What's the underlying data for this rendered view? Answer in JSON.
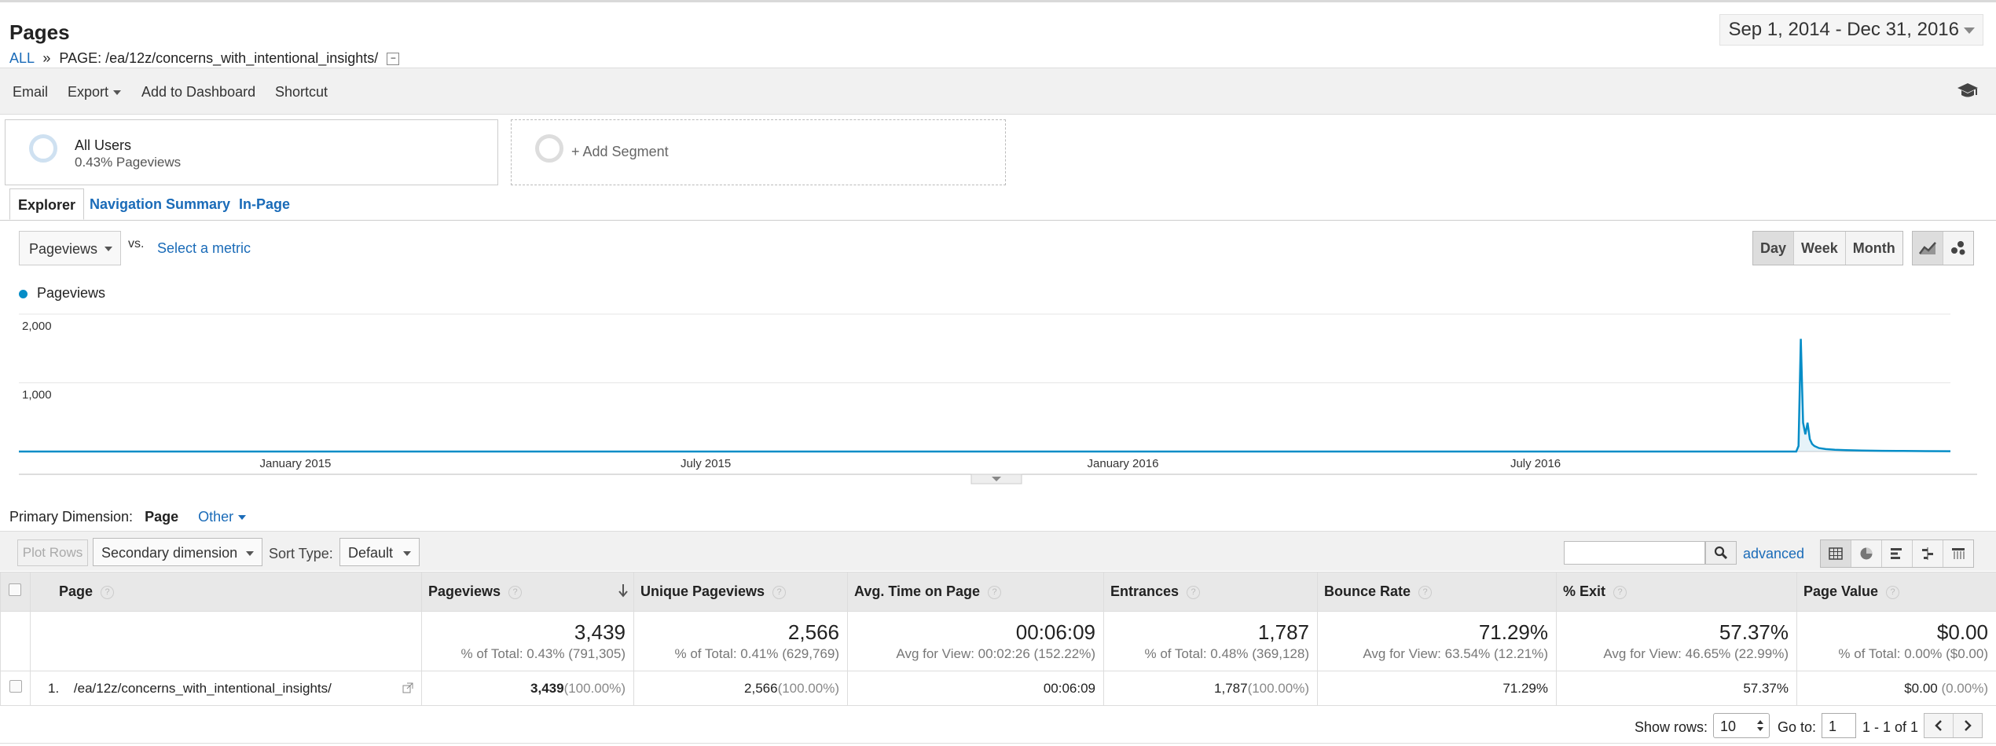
{
  "header": {
    "title": "Pages",
    "breadcrumb_all": "ALL",
    "breadcrumb_sep": "»",
    "breadcrumb_page": "PAGE: /ea/12z/concerns_with_intentional_insights/",
    "date_range": "Sep 1, 2014 - Dec 31, 2016"
  },
  "toolbar": {
    "email": "Email",
    "export": "Export",
    "add_dashboard": "Add to Dashboard",
    "shortcut": "Shortcut",
    "icon": "graduation-cap-icon"
  },
  "segments": {
    "segment1_name": "All Users",
    "segment1_detail": "0.43% Pageviews",
    "add_segment": "+ Add Segment"
  },
  "tabs": [
    "Explorer",
    "Navigation Summary",
    "In-Page"
  ],
  "chart_controls": {
    "metric": "Pageviews",
    "vs": "vs.",
    "select_metric": "Select a metric",
    "granularity": [
      "Day",
      "Week",
      "Month"
    ],
    "active_granularity": "Day"
  },
  "chart_data": {
    "type": "line",
    "title": "",
    "series_name": "Pageviews",
    "color": "#058dc7",
    "ylim": [
      0,
      2000
    ],
    "y_ticks": [
      1000,
      2000
    ],
    "y_tick_labels": [
      "1,000",
      "2,000"
    ],
    "x_tick_labels": [
      "January 2015",
      "July 2015",
      "January 2016",
      "July 2016"
    ],
    "x_tick_dates": [
      "2015-01-01",
      "2015-07-01",
      "2016-01-01",
      "2016-07-01"
    ],
    "x_range": [
      "2014-09-01",
      "2016-12-31"
    ],
    "points": [
      {
        "x": "2014-09-01",
        "y": 0
      },
      {
        "x": "2016-10-24",
        "y": 0
      },
      {
        "x": "2016-10-25",
        "y": 80
      },
      {
        "x": "2016-10-26",
        "y": 1640
      },
      {
        "x": "2016-10-27",
        "y": 420
      },
      {
        "x": "2016-10-28",
        "y": 250
      },
      {
        "x": "2016-10-29",
        "y": 420
      },
      {
        "x": "2016-10-30",
        "y": 180
      },
      {
        "x": "2016-10-31",
        "y": 110
      },
      {
        "x": "2016-11-01",
        "y": 80
      },
      {
        "x": "2016-11-03",
        "y": 50
      },
      {
        "x": "2016-11-06",
        "y": 35
      },
      {
        "x": "2016-11-10",
        "y": 25
      },
      {
        "x": "2016-11-15",
        "y": 20
      },
      {
        "x": "2016-11-22",
        "y": 14
      },
      {
        "x": "2016-12-01",
        "y": 10
      },
      {
        "x": "2016-12-10",
        "y": 8
      },
      {
        "x": "2016-12-20",
        "y": 6
      },
      {
        "x": "2016-12-31",
        "y": 5
      }
    ]
  },
  "dimension": {
    "label": "Primary Dimension:",
    "active": "Page",
    "other": "Other"
  },
  "table_toolbar": {
    "plot_rows": "Plot Rows",
    "secondary_dimension": "Secondary dimension",
    "sort_type_label": "Sort Type:",
    "sort_type": "Default",
    "advanced": "advanced"
  },
  "table": {
    "columns": [
      "Page",
      "Pageviews",
      "Unique Pageviews",
      "Avg. Time on Page",
      "Entrances",
      "Bounce Rate",
      "% Exit",
      "Page Value"
    ],
    "totals": [
      {
        "value": "3,439",
        "sub": "% of Total: 0.43% (791,305)"
      },
      {
        "value": "2,566",
        "sub": "% of Total: 0.41% (629,769)"
      },
      {
        "value": "00:06:09",
        "sub": "Avg for View: 00:02:26 (152.22%)"
      },
      {
        "value": "1,787",
        "sub": "% of Total: 0.48% (369,128)"
      },
      {
        "value": "71.29%",
        "sub": "Avg for View: 63.54% (12.21%)"
      },
      {
        "value": "57.37%",
        "sub": "Avg for View: 46.65% (22.99%)"
      },
      {
        "value": "$0.00",
        "sub": "% of Total: 0.00% ($0.00)"
      }
    ],
    "rows": [
      {
        "index": "1.",
        "page": "/ea/12z/concerns_with_intentional_insights/",
        "pageviews": "3,439",
        "pageviews_pct": "(100.00%)",
        "unique": "2,566",
        "unique_pct": "(100.00%)",
        "avg_time": "00:06:09",
        "entrances": "1,787",
        "entrances_pct": "(100.00%)",
        "bounce": "71.29%",
        "exit": "57.37%",
        "value": "$0.00",
        "value_pct": "(0.00%)"
      }
    ]
  },
  "footer": {
    "show_rows": "Show rows:",
    "rows_value": "10",
    "goto": "Go to:",
    "goto_value": "1",
    "range": "1 - 1 of 1"
  }
}
